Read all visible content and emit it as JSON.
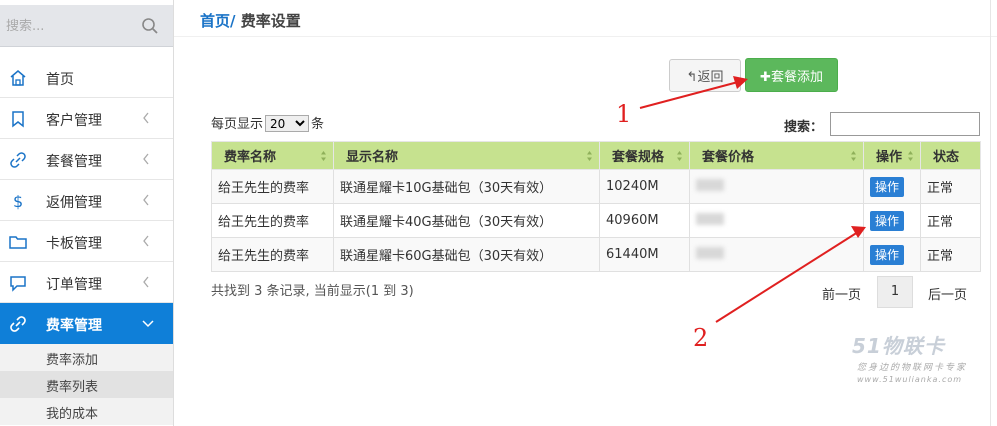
{
  "sidebar": {
    "search_placeholder": "搜索...",
    "items": [
      {
        "label": "首页",
        "icon": "home-icon",
        "chevron": false,
        "active": false
      },
      {
        "label": "客户管理",
        "icon": "bookmark-icon",
        "chevron": true,
        "active": false
      },
      {
        "label": "套餐管理",
        "icon": "link-icon",
        "chevron": true,
        "active": false
      },
      {
        "label": "返佣管理",
        "icon": "dollar-icon",
        "chevron": true,
        "active": false
      },
      {
        "label": "卡板管理",
        "icon": "folder-icon",
        "chevron": true,
        "active": false
      },
      {
        "label": "订单管理",
        "icon": "comment-icon",
        "chevron": true,
        "active": false
      },
      {
        "label": "费率管理",
        "icon": "link-icon",
        "chevron": true,
        "active": true
      }
    ],
    "subitems": [
      {
        "label": "费率添加"
      },
      {
        "label": "费率列表",
        "selected": true
      },
      {
        "label": "我的成本"
      }
    ]
  },
  "breadcrumb": {
    "home": "首页",
    "separator": "/",
    "current": "费率设置"
  },
  "toolbar": {
    "back_label": "返回",
    "add_label": "套餐添加"
  },
  "list": {
    "per_page_prefix": "每页显示",
    "per_page_value": "20",
    "per_page_suffix": "条",
    "search_label": "搜索："
  },
  "table": {
    "columns": [
      "费率名称",
      "显示名称",
      "套餐规格",
      "套餐价格",
      "操作",
      "状态"
    ],
    "rows": [
      {
        "rate_name": "给王先生的费率",
        "display_name": "联通星耀卡10G基础包（30天有效）",
        "spec": "10240M",
        "action": "操作",
        "status": "正常"
      },
      {
        "rate_name": "给王先生的费率",
        "display_name": "联通星耀卡40G基础包（30天有效）",
        "spec": "40960M",
        "action": "操作",
        "status": "正常"
      },
      {
        "rate_name": "给王先生的费率",
        "display_name": "联通星耀卡60G基础包（30天有效）",
        "spec": "61440M",
        "action": "操作",
        "status": "正常"
      }
    ]
  },
  "footer": {
    "info": "共找到 3 条记录, 当前显示(1 到 3)",
    "prev": "前一页",
    "page": "1",
    "next": "后一页"
  },
  "annotations": {
    "one": "1",
    "two": "2"
  },
  "watermark": {
    "logo": "51物联卡",
    "tagline": "您身边的物联网卡专家",
    "url": "www.51wulianka.com"
  },
  "colors": {
    "accent": "#0f7fd8",
    "add_button": "#5cb85c",
    "table_header": "#c6e28f",
    "op_button": "#2a7fd4",
    "annotation": "#e02020"
  }
}
